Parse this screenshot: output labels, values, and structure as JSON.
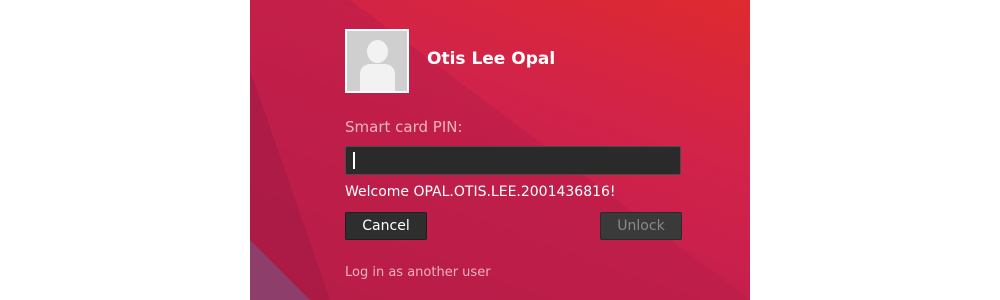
{
  "user": {
    "name": "Otis Lee Opal",
    "avatar_icon": "user-avatar-icon"
  },
  "auth": {
    "pin_label": "Smart card PIN:",
    "pin_value": "",
    "welcome_message": "Welcome OPAL.OTIS.LEE.2001436816!"
  },
  "actions": {
    "cancel_label": "Cancel",
    "unlock_label": "Unlock",
    "another_user_label": "Log in as another user"
  },
  "colors": {
    "background_primary": "#d22349",
    "input_background": "#2a2a2a",
    "button_background": "#2e2e2e"
  }
}
